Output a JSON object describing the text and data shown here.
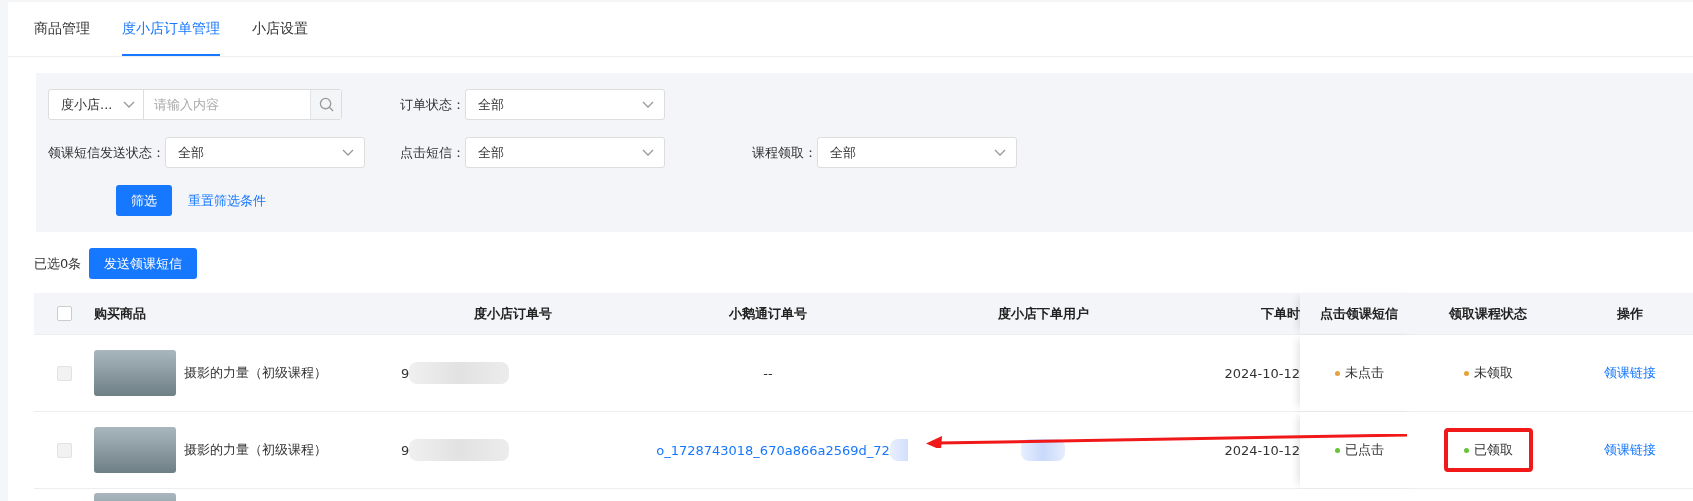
{
  "tabs": [
    {
      "label": "商品管理",
      "selected": false
    },
    {
      "label": "度小店订单管理",
      "selected": true
    },
    {
      "label": "小店设置",
      "selected": false
    }
  ],
  "filters": {
    "search": {
      "scope": "度小店...",
      "placeholder": "请输入内容"
    },
    "row_1": [
      {
        "label": "订单状态：",
        "value": "全部"
      }
    ],
    "row_2": [
      {
        "label": "领课短信发送状态：",
        "value": "全部"
      },
      {
        "label": "点击短信：",
        "value": "全部"
      },
      {
        "label": "课程领取：",
        "value": "全部"
      }
    ],
    "submit": "筛选",
    "reset": "重置筛选条件"
  },
  "selection": {
    "count": "已选0条",
    "send_button": "发送领课短信"
  },
  "table": {
    "header_checkbox": {
      "checked": false
    },
    "columns": [
      "购买商品",
      "度小店订单号",
      "小鹅通订单号",
      "度小店下单用户",
      "下单时",
      "点击领课短信",
      "领取课程状态",
      "操作"
    ],
    "rows": [
      {
        "kind": "full",
        "checkbox": {
          "checked": false,
          "disabled": true
        },
        "product": "摄影的力量（初级课程）",
        "order_no": "9",
        "xiaoe_order": {
          "kind": "text",
          "text": "--"
        },
        "user_redacted": false,
        "date": "2024-10-12",
        "click_status": {
          "text": "未点击",
          "color": "#e6a23c"
        },
        "claim_status": {
          "text": "未领取",
          "color": "#e6a23c",
          "highlighted": false
        },
        "action": "领课链接",
        "arrow": false
      },
      {
        "kind": "full",
        "checkbox": {
          "checked": false,
          "disabled": true
        },
        "product": "摄影的力量（初级课程）",
        "order_no": "9",
        "xiaoe_order": {
          "kind": "link",
          "text": "o_1728743018_670a866a2569d_72"
        },
        "user_redacted": true,
        "date": "2024-10-12",
        "click_status": {
          "text": "已点击",
          "color": "#67c23a"
        },
        "claim_status": {
          "text": "已领取",
          "color": "#67c23a",
          "highlighted": true
        },
        "action": "领课链接",
        "arrow": true
      },
      {
        "kind": "partial"
      }
    ]
  }
}
